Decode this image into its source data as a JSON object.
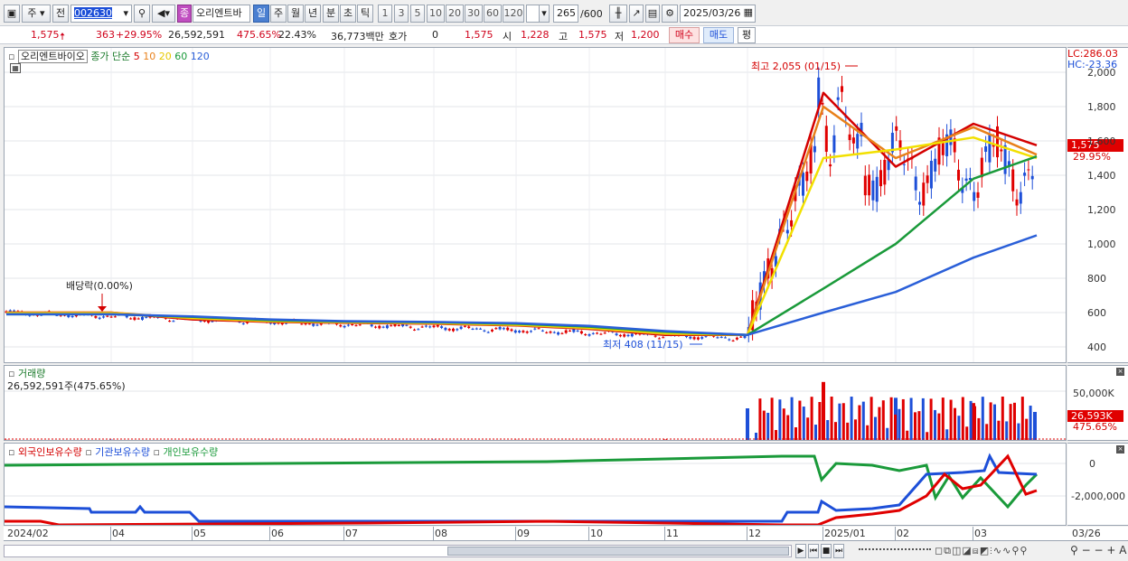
{
  "toolbar": {
    "market": "주",
    "prev": "전",
    "code": "002630",
    "name_badge": "종",
    "name": "오리엔트바",
    "periods": [
      "일",
      "주",
      "월",
      "년",
      "분",
      "초",
      "틱"
    ],
    "minutes": [
      "1",
      "3",
      "5",
      "10",
      "20",
      "30",
      "60",
      "120"
    ],
    "count": "265",
    "count_max": "/600",
    "date": "2025/03/26"
  },
  "quote": {
    "price": "1,575",
    "change": "363",
    "change_pct": "+29.95%",
    "volume": "26,592,591",
    "vol_ratio": "475.65%",
    "turnover": "22.43%",
    "amount": "36,773백만",
    "hoga_label": "호가",
    "hoga_value": "0",
    "hoga_price": "1,575",
    "open_label": "시",
    "open": "1,228",
    "high_label": "고",
    "high": "1,575",
    "low_label": "저",
    "low": "1,200",
    "buy": "매수",
    "sell": "매도",
    "avg": "평"
  },
  "price_panel": {
    "stock": "오리엔트바이오",
    "ma_label": "종가 단순",
    "ma_periods": [
      "5",
      "10",
      "20",
      "60",
      "120"
    ],
    "ma_colors": [
      "#d40000",
      "#e8801a",
      "#f2e000",
      "#1a9a3a",
      "#2a5fd8"
    ],
    "lc": "LC:286.03",
    "hc": "HC:-23.36",
    "high_note": "최고 2,055 (01/15)",
    "low_note": "최저 408 (11/15)",
    "div_note": "배당락(0.00%)",
    "current_price": "1,575",
    "current_pct": "29.95%",
    "y_ticks": [
      "2,000",
      "1,800",
      "1,600",
      "1,400",
      "1,200",
      "1,000",
      "800",
      "600",
      "400"
    ]
  },
  "volume_panel": {
    "title": "거래량",
    "value": "26,592,591주(475.65%)",
    "tick": "50,000K",
    "current": "26,593K",
    "current_pct": "475.65%"
  },
  "holder_panel": {
    "foreign": "외국인보유수량",
    "inst": "기관보유수량",
    "indiv": "개인보유수량",
    "ticks": [
      "0",
      "-2,000,000"
    ]
  },
  "x_axis": [
    "2024/02",
    "04",
    "05",
    "06",
    "07",
    "08",
    "09",
    "10",
    "11",
    "12",
    "2025/01",
    "02",
    "03",
    "03/26"
  ],
  "chart_data": [
    {
      "type": "line",
      "title": "오리엔트바이오",
      "ylim": [
        400,
        2055
      ],
      "x": [
        "2024/02",
        "04",
        "05",
        "06",
        "07",
        "08",
        "09",
        "10",
        "11",
        "12",
        "2025/01",
        "02",
        "03",
        "03/26"
      ],
      "series": [
        {
          "name": "5",
          "values": [
            600,
            600,
            560,
            545,
            540,
            535,
            525,
            505,
            470,
            470,
            1880,
            1450,
            1700,
            1575
          ]
        },
        {
          "name": "10",
          "values": [
            600,
            600,
            565,
            548,
            542,
            537,
            527,
            508,
            475,
            470,
            1800,
            1500,
            1680,
            1520
          ]
        },
        {
          "name": "20",
          "values": [
            595,
            595,
            570,
            552,
            545,
            540,
            530,
            512,
            480,
            470,
            1500,
            1550,
            1620,
            1500
          ]
        },
        {
          "name": "60",
          "values": [
            590,
            590,
            575,
            556,
            548,
            543,
            535,
            518,
            488,
            470,
            740,
            1000,
            1380,
            1510
          ]
        },
        {
          "name": "120",
          "values": [
            590,
            590,
            578,
            560,
            550,
            545,
            538,
            522,
            492,
            470,
            600,
            720,
            920,
            1050
          ]
        }
      ]
    },
    {
      "type": "bar",
      "title": "거래량",
      "x": [
        "2024/02",
        "04",
        "05",
        "06",
        "07",
        "08",
        "09",
        "10",
        "11",
        "12",
        "2025/01",
        "02",
        "03",
        "03/26"
      ],
      "values": [
        200,
        250,
        150,
        120,
        100,
        180,
        120,
        100,
        400,
        30000,
        55000,
        40000,
        35000,
        26593
      ]
    }
  ]
}
